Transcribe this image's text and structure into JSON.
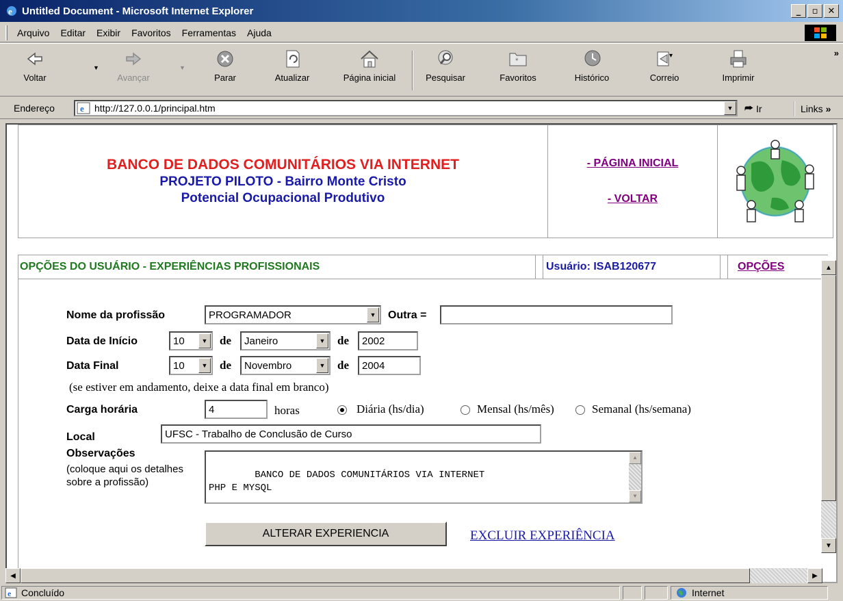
{
  "window": {
    "title": "Untitled Document - Microsoft Internet Explorer"
  },
  "menu": {
    "items": [
      "Arquivo",
      "Editar",
      "Exibir",
      "Favoritos",
      "Ferramentas",
      "Ajuda"
    ]
  },
  "toolbar": {
    "back": "Voltar",
    "forward": "Avançar",
    "stop": "Parar",
    "refresh": "Atualizar",
    "home": "Página inicial",
    "search": "Pesquisar",
    "favorites": "Favoritos",
    "history": "Histórico",
    "mail": "Correio",
    "print": "Imprimir"
  },
  "address": {
    "label": "Endereço",
    "url": "http://127.0.0.1/principal.htm",
    "go": "Ir",
    "links": "Links"
  },
  "header": {
    "line1": "BANCO DE DADOS COMUNITÁRIOS VIA INTERNET",
    "line2": "PROJETO PILOTO - Bairro Monte Cristo",
    "line3": "Potencial Ocupacional Produtivo",
    "link_home": "- PÁGINA INICIAL",
    "link_back": "- VOLTAR"
  },
  "options_bar": {
    "title": "OPÇÕES DO USUÁRIO - EXPERIÊNCIAS PROFISSIONAIS",
    "user": "Usuário: ISAB120677",
    "link": "OPÇÕES"
  },
  "form": {
    "profession_label": "Nome da profissão",
    "profession_value": "PROGRAMADOR",
    "other_label": "Outra =",
    "other_value": "",
    "start_label": "Data de Início",
    "start_day": "10",
    "start_month": "Janeiro",
    "start_year": "2002",
    "end_label": "Data Final",
    "end_day": "10",
    "end_month": "Novembro",
    "end_year": "2004",
    "de": "de",
    "end_hint": "(se estiver em andamento, deixe a data final em branco)",
    "hours_label": "Carga horária",
    "hours_value": "4",
    "hours_unit": "horas",
    "radio_daily": "Diária (hs/dia)",
    "radio_monthly": "Mensal (hs/mês)",
    "radio_weekly": "Semanal (hs/semana)",
    "place_label": "Local",
    "place_value": "UFSC - Trabalho de Conclusão de Curso",
    "obs_label": "Observações",
    "obs_hint": "(coloque aqui os detalhes sobre a profissão)",
    "obs_value": "BANCO DE DADOS COMUNITÁRIOS VIA INTERNET\nPHP E MYSQL",
    "submit": "ALTERAR EXPERIENCIA",
    "delete_link": "EXCLUIR EXPERIÊNCIA"
  },
  "status": {
    "text": "Concluído",
    "zone": "Internet"
  },
  "icons": {
    "back": "back-arrow-icon",
    "forward": "forward-arrow-icon",
    "stop": "stop-icon",
    "refresh": "refresh-icon",
    "home": "home-icon",
    "search": "search-icon",
    "favorites": "favorites-icon",
    "history": "history-icon",
    "mail": "mail-icon",
    "print": "print-icon",
    "globe": "globe-people-icon"
  },
  "colors": {
    "titlebar": "#0a246a",
    "header_red": "#e02020",
    "header_blue": "#1a1aa8",
    "green_title": "#1f7a1f",
    "visited_link": "#800080"
  }
}
